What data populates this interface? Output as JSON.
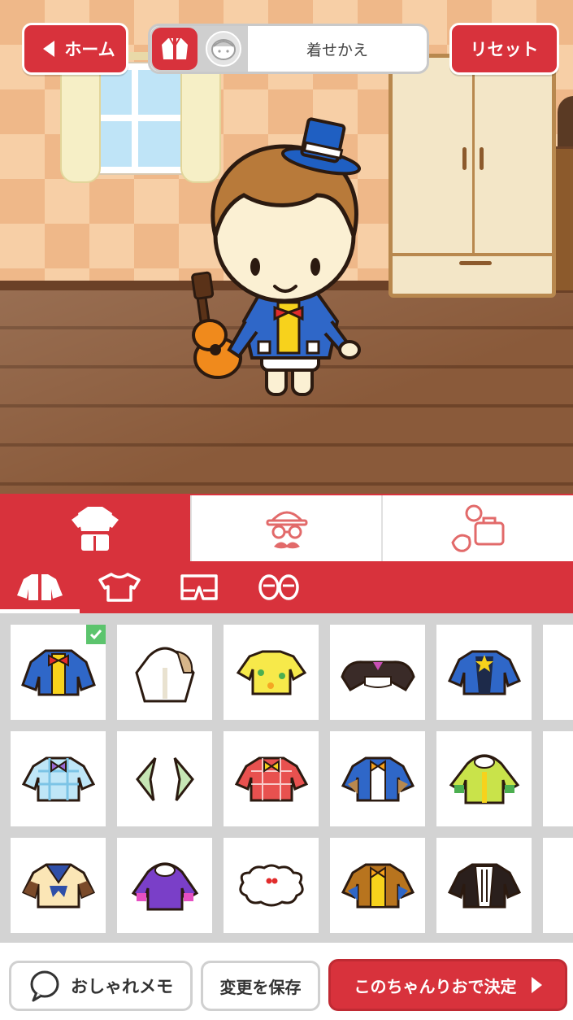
{
  "header": {
    "home_label": "ホーム",
    "mode_label": "着せかえ",
    "reset_label": "リセット"
  },
  "category_tabs": [
    {
      "name": "clothes",
      "icon": "clothes-icon",
      "active": true
    },
    {
      "name": "face-accessories",
      "icon": "hat-glasses-mustache-icon",
      "active": false
    },
    {
      "name": "items",
      "icon": "bag-items-icon",
      "active": false
    }
  ],
  "sub_tabs": [
    {
      "name": "jacket",
      "icon": "jacket-icon",
      "active": true
    },
    {
      "name": "shirt",
      "icon": "shirt-icon",
      "active": false
    },
    {
      "name": "pants",
      "icon": "shorts-icon",
      "active": false
    },
    {
      "name": "shoes",
      "icon": "shoes-icon",
      "active": false
    }
  ],
  "items": [
    {
      "name": "blue-blazer-red-bow",
      "selected": true
    },
    {
      "name": "white-hoodie"
    },
    {
      "name": "yellow-hawaiian-shirt"
    },
    {
      "name": "black-frill-cape"
    },
    {
      "name": "blue-star-jacket"
    },
    {
      "name": "blue-plaid-shirt"
    },
    {
      "name": "green-collar"
    },
    {
      "name": "red-heart-plaid-shirt"
    },
    {
      "name": "blue-vest-yellow-bow"
    },
    {
      "name": "yellow-raincoat"
    },
    {
      "name": "cream-sailor-top"
    },
    {
      "name": "purple-hoodie"
    },
    {
      "name": "white-fluffy-top"
    },
    {
      "name": "brown-vest-yellow-bow"
    },
    {
      "name": "black-suit-jacket"
    }
  ],
  "bottom": {
    "memo_label": "おしゃれメモ",
    "save_label": "変更を保存",
    "decide_label": "このちゃんりおで決定"
  },
  "colors": {
    "accent": "#d8323c",
    "check": "#5cc46d",
    "grid_bg": "#d3d3d3"
  }
}
